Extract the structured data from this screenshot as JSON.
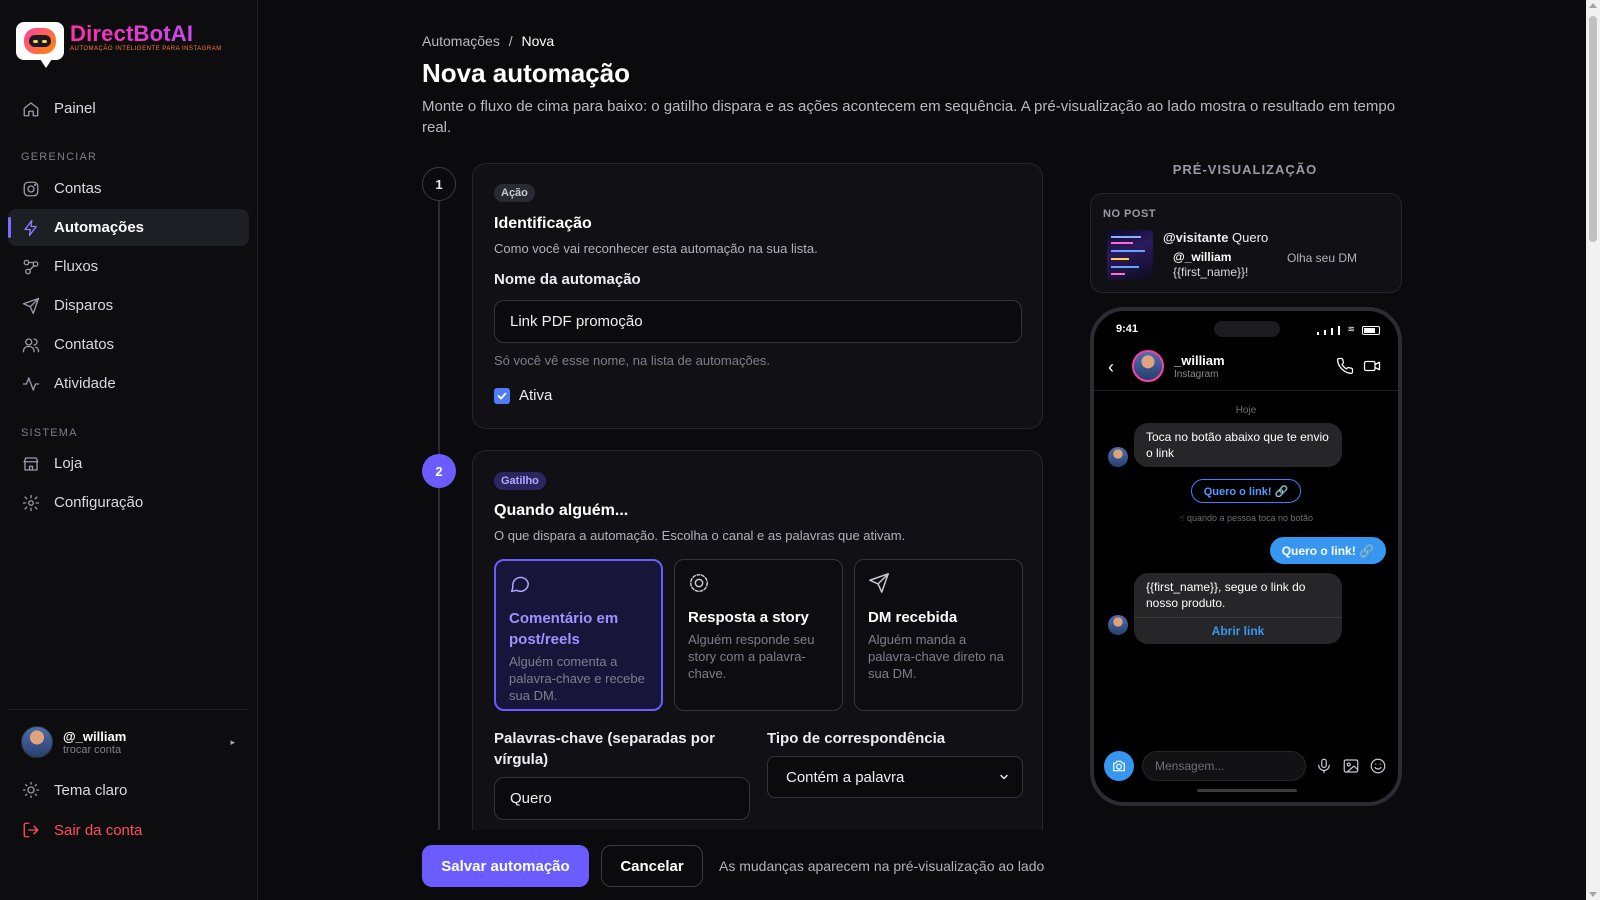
{
  "brand": {
    "name": "DirectBotAI",
    "tagline": "AUTOMAÇÃO INTELIGENTE PARA INSTAGRAM"
  },
  "sidebar": {
    "top_item": {
      "label": "Painel",
      "icon": "home-icon"
    },
    "section_manage": "GERENCIAR",
    "manage_items": [
      {
        "label": "Contas",
        "icon": "instagram-icon"
      },
      {
        "label": "Automações",
        "icon": "bolt-icon",
        "active": true
      },
      {
        "label": "Fluxos",
        "icon": "flow-icon"
      },
      {
        "label": "Disparos",
        "icon": "send-icon"
      },
      {
        "label": "Contatos",
        "icon": "users-icon"
      },
      {
        "label": "Atividade",
        "icon": "activity-icon"
      }
    ],
    "section_system": "SISTEMA",
    "system_items": [
      {
        "label": "Loja",
        "icon": "store-icon"
      },
      {
        "label": "Configuração",
        "icon": "gear-icon"
      }
    ],
    "user": {
      "name": "@_william",
      "sub": "trocar conta"
    },
    "theme_label": "Tema claro",
    "logout_label": "Sair da conta"
  },
  "main": {
    "breadcrumb": {
      "parent": "Automações",
      "sep": "/",
      "current": "Nova"
    },
    "title": "Nova automação",
    "description": "Monte o fluxo de cima para baixo: o gatilho dispara e as ações acontecem em sequência. A pré-visualização ao lado mostra o resultado em tempo real.",
    "step1": {
      "number": "1",
      "tag": "Ação",
      "heading": "Identificação",
      "subtitle": "Como você vai reconhecer esta automação na sua lista.",
      "name_label": "Nome da automação",
      "name_value": "Link PDF promoção",
      "name_hint": "Só você vê esse nome, na lista de automações.",
      "active_label": "Ativa",
      "active_checked": true
    },
    "step2": {
      "number": "2",
      "tag": "Gatilho",
      "heading": "Quando alguém...",
      "subtitle": "O que dispara a automação. Escolha o canal e as palavras que ativam.",
      "options": [
        {
          "title": "Comentário em post/reels",
          "desc": "Alguém comenta a palavra-chave e recebe sua DM.",
          "icon": "comment-icon",
          "selected": true
        },
        {
          "title": "Resposta a story",
          "desc": "Alguém responde seu story com a palavra-chave.",
          "icon": "story-icon",
          "selected": false
        },
        {
          "title": "DM recebida",
          "desc": "Alguém manda a palavra-chave direto na sua DM.",
          "icon": "send-icon",
          "selected": false
        }
      ],
      "keywords_label": "Palavras-chave (separadas por vírgula)",
      "keywords_value": "Quero",
      "match_label": "Tipo de correspondência",
      "match_value": "Contém a palavra"
    },
    "footer": {
      "save_label": "Salvar automação",
      "cancel_label": "Cancelar",
      "note": "As mudanças aparecem na pré-visualização ao lado"
    }
  },
  "preview": {
    "title": "PRÉ-VISUALIZAÇÃO",
    "post": {
      "label": "NO POST",
      "commenter": "@visitante",
      "comment": "Quero",
      "reply_user": "@_william",
      "reply_text": "{{first_name}}!",
      "reply_text2": "Olha seu DM"
    },
    "phone": {
      "time": "9:41",
      "contact_name": "_william",
      "contact_sub": "Instagram",
      "day": "Hoje",
      "msg1": "Toca no botão abaixo que te envio o link",
      "button_label": "Quero o link! 🔗",
      "tap_note": "☝ quando a pessoa toca no botão",
      "user_reply": "Quero o link! 🔗",
      "msg2": "{{first_name}}, segue o link do nosso produto.",
      "msg2_button": "Abrir link",
      "input_placeholder": "Mensagem..."
    }
  },
  "colors": {
    "accent": "#6b5cff",
    "instagram_blue": "#3797f0",
    "danger": "#ff4d5e"
  }
}
